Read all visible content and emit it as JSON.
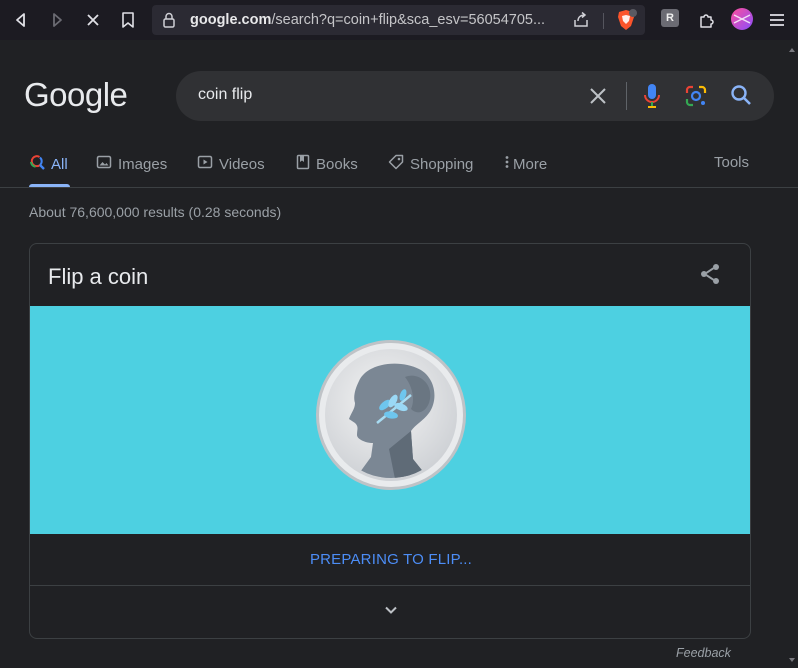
{
  "browser": {
    "url_host": "google.com",
    "url_rest": "/search?q=coin+flip&sca_esv=56054705...",
    "icons": [
      "back-icon",
      "forward-icon",
      "stop-icon",
      "bookmark-icon",
      "lock-icon",
      "share-page-icon",
      "brave-shield-icon",
      "extension-r-icon",
      "extensions-puzzle-icon",
      "profile-icon",
      "menu-icon"
    ],
    "extension_letter": "R"
  },
  "google": {
    "logo": "Google",
    "query": "coin flip",
    "tabs": [
      {
        "label": "All",
        "icon": "search-icon"
      },
      {
        "label": "Images",
        "icon": "image-icon"
      },
      {
        "label": "Videos",
        "icon": "video-icon"
      },
      {
        "label": "Books",
        "icon": "book-icon"
      },
      {
        "label": "Shopping",
        "icon": "tag-icon"
      },
      {
        "label": "More",
        "icon": "more-vertical-icon"
      }
    ],
    "tools_label": "Tools",
    "stats": "About 76,600,000 results (0.28 seconds)"
  },
  "card": {
    "title": "Flip a coin",
    "status": "PREPARING TO FLIP...",
    "feedback": "Feedback"
  },
  "colors": {
    "background": "#202124",
    "coin_bg": "#4dd0e1",
    "accent": "#8ab4f8",
    "status": "#4c8df6"
  }
}
